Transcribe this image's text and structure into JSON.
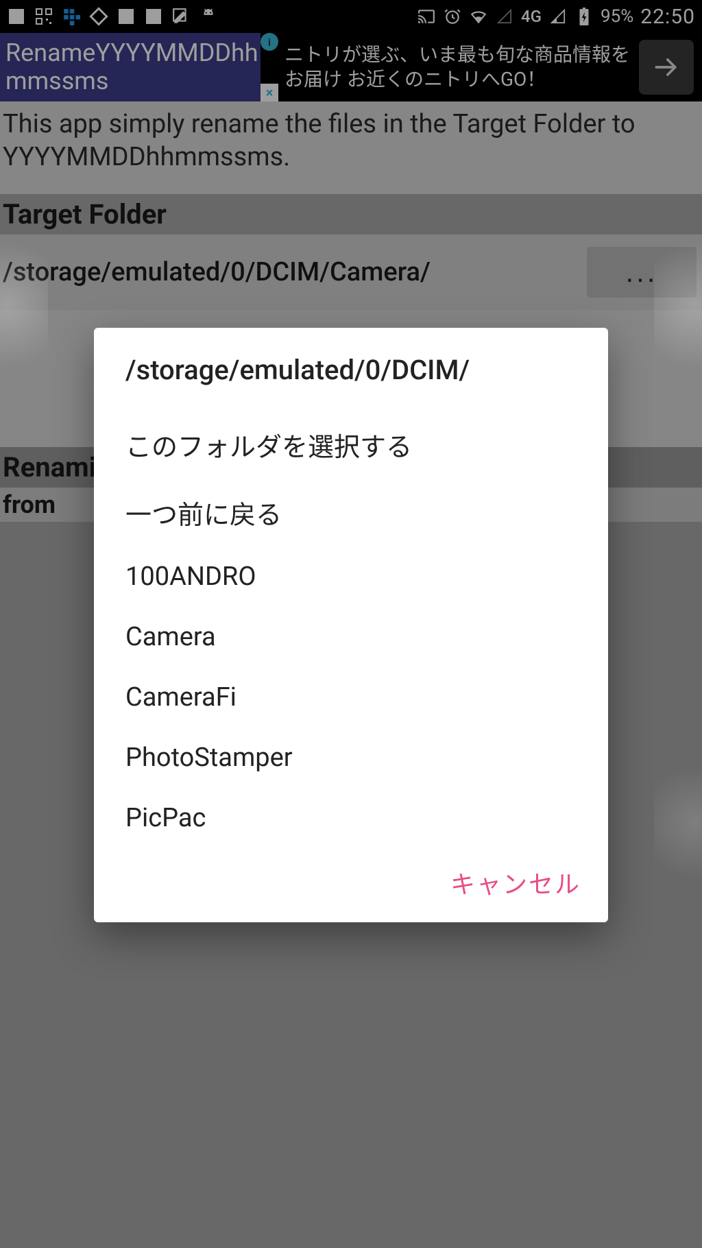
{
  "status_bar": {
    "network": "4G",
    "battery": "95%",
    "time": "22:50"
  },
  "app_bar": {
    "title": "RenameYYYYMMDDhhmmssms"
  },
  "ad": {
    "text": "ニトリが選ぶ、いま最も旬な商品情報をお届け お近くのニトリへGO！"
  },
  "description": "This app simply rename the files in the Target Folder to YYYYMMDDhhmmssms.",
  "sections": {
    "target_folder_label": "Target Folder",
    "target_folder_path": "/storage/emulated/0/DCIM/Camera/",
    "more_button": "...",
    "renaming_label": "Renami",
    "from_label": "from"
  },
  "dialog": {
    "title": "/storage/emulated/0/DCIM/",
    "items": [
      "このフォルダを選択する",
      "一つ前に戻る",
      "100ANDRO",
      "Camera",
      "CameraFi",
      "PhotoStamper",
      "PicPac"
    ],
    "cancel": "キャンセル"
  }
}
